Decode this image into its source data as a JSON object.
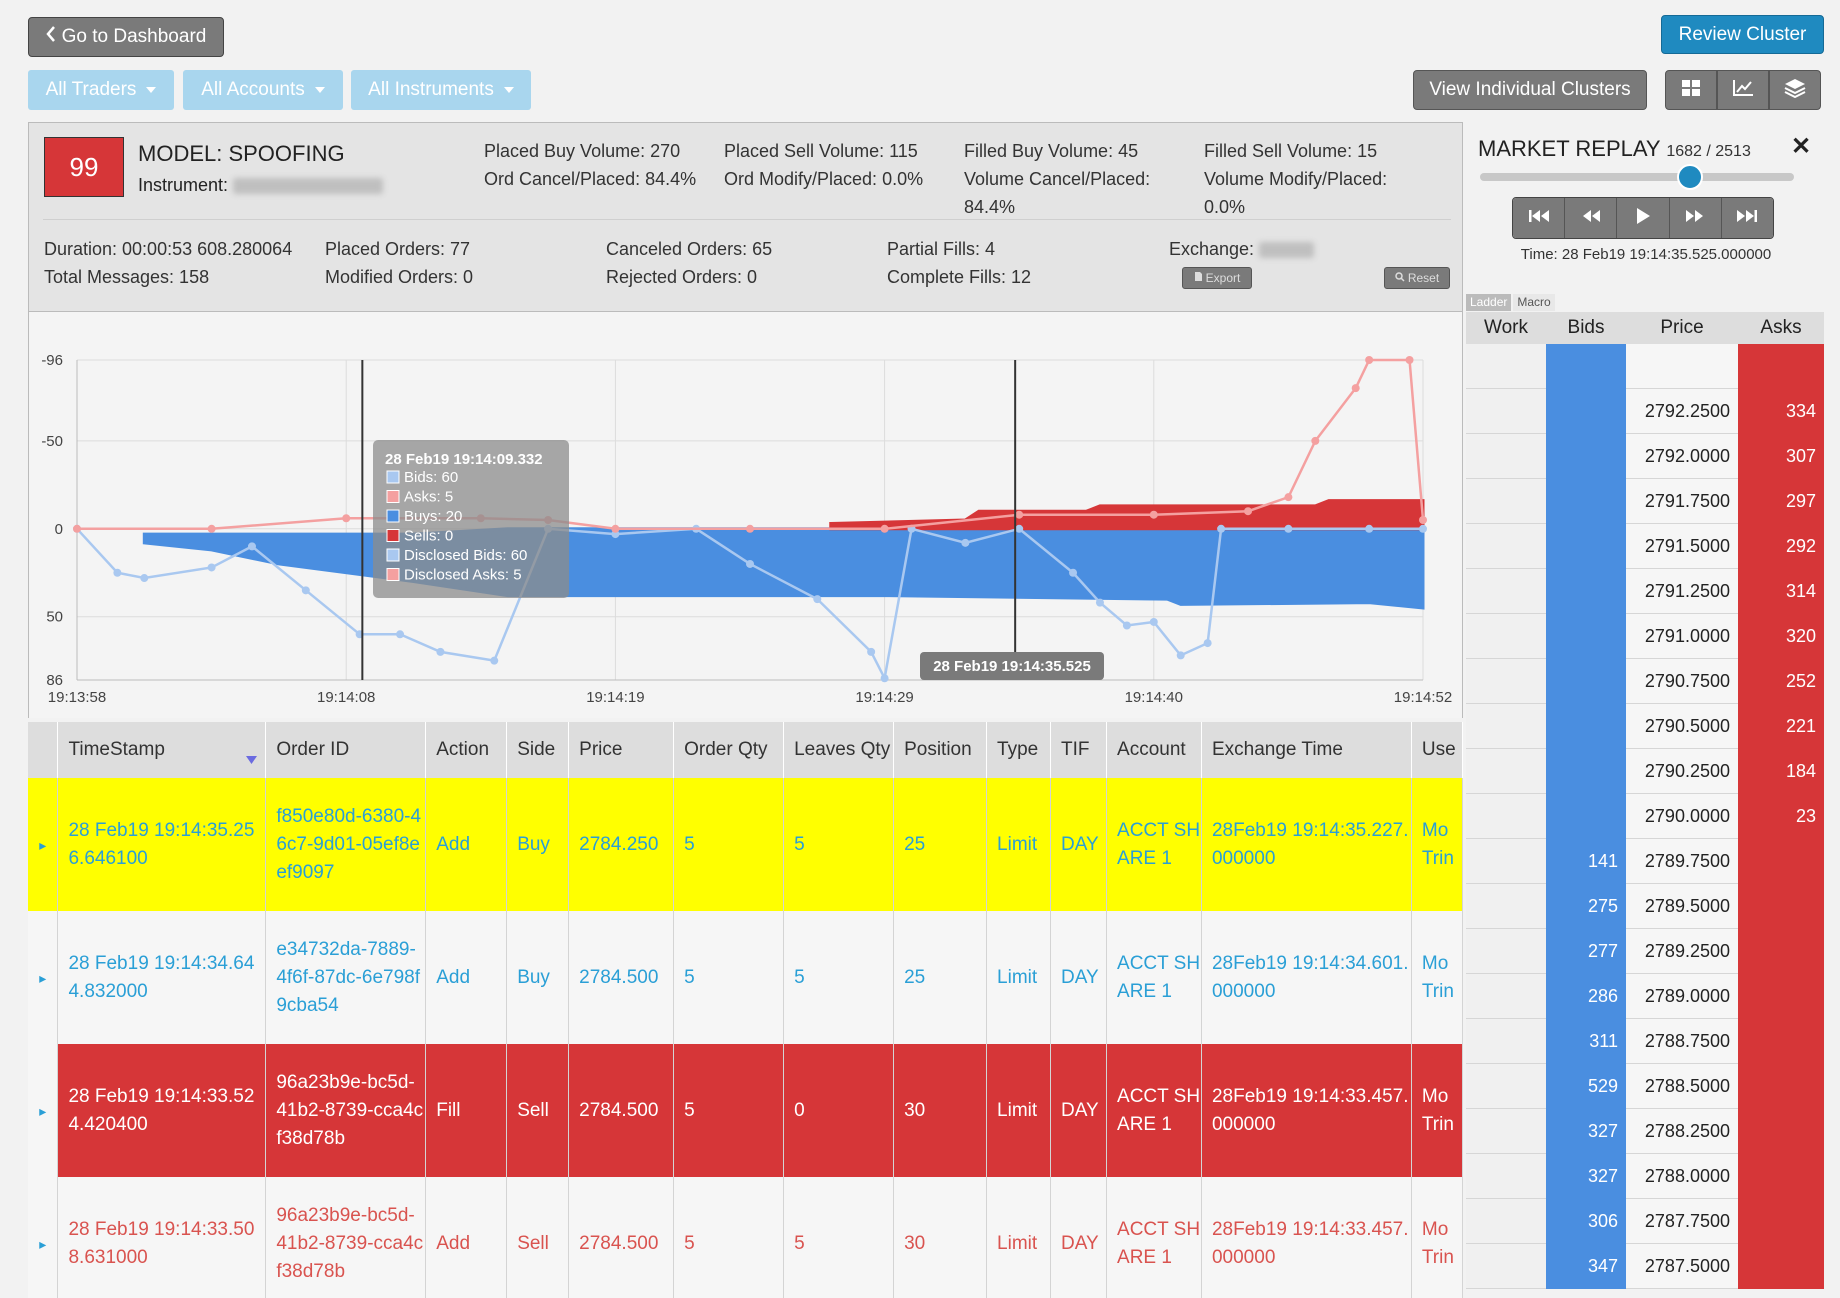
{
  "toolbar": {
    "dashboard_label": "Go to Dashboard",
    "review_label": "Review Cluster",
    "filters": [
      "All Traders",
      "All Accounts",
      "All Instruments"
    ],
    "view_clusters_label": "View Individual Clusters",
    "view_icons": [
      "grid-icon",
      "line-chart-icon",
      "layers-icon"
    ]
  },
  "summary": {
    "score": "99",
    "title": "MODEL: SPOOFING",
    "instrument_label": "Instrument:",
    "exchange_label": "Exchange:",
    "stats_top": [
      [
        "Placed Buy Volume: 270",
        "Ord Cancel/Placed: 84.4%"
      ],
      [
        "Placed Sell Volume: 115",
        "Ord Modify/Placed: 0.0%"
      ],
      [
        "Filled Buy Volume: 45",
        "Volume Cancel/Placed:",
        "84.4%"
      ],
      [
        "Filled Sell Volume: 15",
        "Volume Modify/Placed:",
        "0.0%"
      ]
    ],
    "stats_bottom": [
      [
        "Duration: 00:00:53 608.280064",
        "Total Messages: 158"
      ],
      [
        "Placed Orders: 77",
        "Modified Orders: 0"
      ],
      [
        "Canceled Orders: 65",
        "Rejected Orders: 0"
      ],
      [
        "Partial Fills: 4",
        "Complete Fills: 12"
      ]
    ],
    "export_label": "Export",
    "reset_label": "Reset"
  },
  "chart_data": {
    "type": "area",
    "x_ticks": [
      "19:13:58",
      "19:14:08",
      "19:14:19",
      "19:14:29",
      "19:14:40",
      "19:14:52"
    ],
    "y_ticks": [
      "-96",
      "-50",
      "0",
      "50",
      "86"
    ],
    "ylim": [
      -96,
      86
    ],
    "grid": true,
    "series": [
      {
        "name": "Bids",
        "color": "#a9c8f0",
        "points": [
          [
            0,
            0
          ],
          [
            0.03,
            25
          ],
          [
            0.05,
            28
          ],
          [
            0.1,
            22
          ],
          [
            0.13,
            10
          ],
          [
            0.17,
            35
          ],
          [
            0.21,
            60
          ],
          [
            0.24,
            60
          ],
          [
            0.27,
            70
          ],
          [
            0.31,
            75
          ],
          [
            0.35,
            0
          ],
          [
            0.4,
            3
          ],
          [
            0.46,
            0
          ],
          [
            0.5,
            20
          ],
          [
            0.55,
            40
          ],
          [
            0.59,
            70
          ],
          [
            0.6,
            85
          ],
          [
            0.62,
            0
          ],
          [
            0.66,
            8
          ],
          [
            0.7,
            0
          ],
          [
            0.74,
            25
          ],
          [
            0.76,
            42
          ],
          [
            0.78,
            55
          ],
          [
            0.8,
            53
          ],
          [
            0.82,
            72
          ],
          [
            0.84,
            65
          ],
          [
            0.85,
            0
          ],
          [
            0.9,
            0
          ],
          [
            0.96,
            0
          ],
          [
            1,
            0
          ]
        ]
      },
      {
        "name": "Asks",
        "color": "#f4a0a0",
        "points": [
          [
            0,
            0
          ],
          [
            0.1,
            0
          ],
          [
            0.2,
            -6
          ],
          [
            0.3,
            -6
          ],
          [
            0.35,
            -5
          ],
          [
            0.4,
            0
          ],
          [
            0.5,
            0
          ],
          [
            0.6,
            0
          ],
          [
            0.7,
            -8
          ],
          [
            0.8,
            -8
          ],
          [
            0.87,
            -10
          ],
          [
            0.9,
            -18
          ],
          [
            0.92,
            -50
          ],
          [
            0.95,
            -80
          ],
          [
            0.96,
            -96
          ],
          [
            0.99,
            -96
          ],
          [
            1,
            -5
          ]
        ]
      },
      {
        "name": "Buys",
        "color": "#4a8ee0",
        "band": [
          [
            0.05,
            8,
            3
          ],
          [
            0.1,
            12,
            3
          ],
          [
            0.15,
            20,
            3
          ],
          [
            0.25,
            30,
            3
          ],
          [
            0.32,
            38,
            0
          ],
          [
            0.6,
            38,
            0
          ],
          [
            0.81,
            40,
            0
          ],
          [
            0.82,
            43,
            0
          ],
          [
            0.96,
            42,
            0
          ],
          [
            1,
            45,
            0
          ]
        ]
      },
      {
        "name": "Sells",
        "color": "#d63638",
        "band": [
          [
            0.56,
            -3,
            0
          ],
          [
            0.66,
            -5,
            0
          ],
          [
            0.67,
            -10,
            0
          ],
          [
            0.75,
            -10,
            0
          ],
          [
            0.76,
            -13,
            0
          ],
          [
            0.92,
            -13,
            0
          ],
          [
            0.93,
            -16,
            0
          ],
          [
            1,
            -16,
            0
          ]
        ]
      }
    ],
    "cursor_lines_x": [
      0.212,
      0.697
    ],
    "tooltip": {
      "title": "28 Feb19 19:14:09.332",
      "items": [
        {
          "label": "Bids: 60",
          "color": "#a9c8f0"
        },
        {
          "label": "Asks: 5",
          "color": "#f4a0a0"
        },
        {
          "label": "Buys: 20",
          "color": "#4a8ee0"
        },
        {
          "label": "Sells: 0",
          "color": "#d63638"
        },
        {
          "label": "Disclosed Bids: 60",
          "color": "#a9c8f0"
        },
        {
          "label": "Disclosed Asks: 5",
          "color": "#f4a0a0"
        }
      ]
    },
    "cursor_label": "28 Feb19 19:14:35.525"
  },
  "table": {
    "columns": [
      "TimeStamp",
      "Order ID",
      "Action",
      "Side",
      "Price",
      "Order Qty",
      "Leaves Qty",
      "Position",
      "Type",
      "TIF",
      "Account",
      "Exchange Time",
      "Use"
    ],
    "rows": [
      {
        "style": "yellow",
        "cells": [
          "28 Feb19 19:14:35.256.646100",
          "f850e80d-6380-46c7-9d01-05ef8eef9097",
          "Add",
          "Buy",
          "2784.250",
          "5",
          "5",
          "25",
          "Limit",
          "DAY",
          "ACCT SHARE 1",
          "28Feb19 19:14:35.227.000000",
          "Mo Trin"
        ]
      },
      {
        "style": "blue",
        "cells": [
          "28 Feb19 19:14:34.644.832000",
          "e34732da-7889-4f6f-87dc-6e798f9cba54",
          "Add",
          "Buy",
          "2784.500",
          "5",
          "5",
          "25",
          "Limit",
          "DAY",
          "ACCT SHARE 1",
          "28Feb19 19:14:34.601.000000",
          "Mo Trin"
        ]
      },
      {
        "style": "red",
        "cells": [
          "28 Feb19 19:14:33.524.420400",
          "96a23b9e-bc5d-41b2-8739-cca4cf38d78b",
          "Fill",
          "Sell",
          "2784.500",
          "5",
          "0",
          "30",
          "Limit",
          "DAY",
          "ACCT SHARE 1",
          "28Feb19 19:14:33.457.000000",
          "Mo Trin"
        ]
      },
      {
        "style": "pink",
        "cells": [
          "28 Feb19 19:14:33.508.631000",
          "96a23b9e-bc5d-41b2-8739-cca4cf38d78b",
          "Add",
          "Sell",
          "2784.500",
          "5",
          "5",
          "30",
          "Limit",
          "DAY",
          "ACCT SHARE 1",
          "28Feb19 19:14:33.457.000000",
          "Mo Trin"
        ]
      }
    ]
  },
  "replay": {
    "title": "MARKET REPLAY",
    "count": "1682 / 2513",
    "progress": 0.67,
    "time": "Time: 28 Feb19 19:14:35.525.000000",
    "controls": [
      "skip-back-icon",
      "rewind-icon",
      "play-icon",
      "fast-forward-icon",
      "skip-forward-icon"
    ],
    "tabs": [
      "Ladder",
      "Macro"
    ],
    "ladder_headers": [
      "Work",
      "Bids",
      "Price",
      "Asks"
    ],
    "ladder_rows": [
      {
        "work": "",
        "bid": "",
        "price": "",
        "ask": ""
      },
      {
        "work": "",
        "bid": "",
        "price": "2792.2500",
        "ask": "334"
      },
      {
        "work": "",
        "bid": "",
        "price": "2792.0000",
        "ask": "307"
      },
      {
        "work": "",
        "bid": "",
        "price": "2791.7500",
        "ask": "297"
      },
      {
        "work": "",
        "bid": "",
        "price": "2791.5000",
        "ask": "292"
      },
      {
        "work": "",
        "bid": "",
        "price": "2791.2500",
        "ask": "314"
      },
      {
        "work": "",
        "bid": "",
        "price": "2791.0000",
        "ask": "320"
      },
      {
        "work": "",
        "bid": "",
        "price": "2790.7500",
        "ask": "252"
      },
      {
        "work": "",
        "bid": "",
        "price": "2790.5000",
        "ask": "221"
      },
      {
        "work": "",
        "bid": "",
        "price": "2790.2500",
        "ask": "184"
      },
      {
        "work": "",
        "bid": "",
        "price": "2790.0000",
        "ask": "23"
      },
      {
        "work": "",
        "bid": "141",
        "price": "2789.7500",
        "ask": ""
      },
      {
        "work": "",
        "bid": "275",
        "price": "2789.5000",
        "ask": ""
      },
      {
        "work": "",
        "bid": "277",
        "price": "2789.2500",
        "ask": ""
      },
      {
        "work": "",
        "bid": "286",
        "price": "2789.0000",
        "ask": ""
      },
      {
        "work": "",
        "bid": "311",
        "price": "2788.7500",
        "ask": ""
      },
      {
        "work": "",
        "bid": "529",
        "price": "2788.5000",
        "ask": ""
      },
      {
        "work": "",
        "bid": "327",
        "price": "2788.2500",
        "ask": ""
      },
      {
        "work": "",
        "bid": "327",
        "price": "2788.0000",
        "ask": ""
      },
      {
        "work": "",
        "bid": "306",
        "price": "2787.7500",
        "ask": ""
      },
      {
        "work": "",
        "bid": "347",
        "price": "2787.5000",
        "ask": ""
      }
    ]
  }
}
